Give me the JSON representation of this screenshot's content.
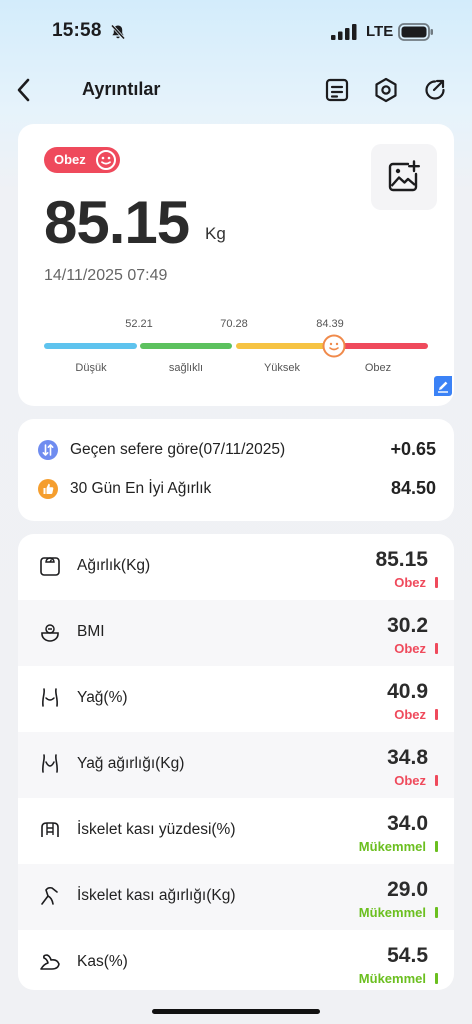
{
  "status_bar": {
    "time": "15:58",
    "network": "LTE"
  },
  "header": {
    "title": "Ayrıntılar"
  },
  "summary": {
    "status": "Obez",
    "weight": "85.15",
    "unit": "Kg",
    "date": "14/11/2025 07:49",
    "scale": {
      "thresholds": [
        "52.21",
        "70.28",
        "84.39"
      ],
      "segments": [
        {
          "label": "Düşük",
          "color": "#5ec3ee"
        },
        {
          "label": "sağlıklı",
          "color": "#5cc15e"
        },
        {
          "label": "Yüksek",
          "color": "#f6c343"
        },
        {
          "label": "Obez",
          "color": "#ef4a5c"
        }
      ],
      "marker_fraction": 0.755
    }
  },
  "compare": [
    {
      "label": "Geçen sefere göre(07/11/2025)",
      "value": "+0.65",
      "icon": "compare-arrows-icon"
    },
    {
      "label": "30 Gün En İyi Ağırlık",
      "value": "84.50",
      "icon": "thumbs-up-icon"
    }
  ],
  "metrics": [
    {
      "label": "Ağırlık(Kg)",
      "value": "85.15",
      "status": "Obez",
      "color": "#ef4a5c",
      "icon": "scale-icon"
    },
    {
      "label": "BMI",
      "value": "30.2",
      "status": "Obez",
      "color": "#ef4a5c",
      "icon": "bmi-icon"
    },
    {
      "label": "Yağ(%)",
      "value": "40.9",
      "status": "Obez",
      "color": "#ef4a5c",
      "icon": "body-fat-icon"
    },
    {
      "label": "Yağ ağırlığı(Kg)",
      "value": "34.8",
      "status": "Obez",
      "color": "#ef4a5c",
      "icon": "fat-weight-icon"
    },
    {
      "label": "İskelet kası yüzdesi(%)",
      "value": "34.0",
      "status": "Mükemmel",
      "color": "#6bbf1f",
      "icon": "skeletal-muscle-icon"
    },
    {
      "label": "İskelet kası ağırlığı(Kg)",
      "value": "29.0",
      "status": "Mükemmel",
      "color": "#6bbf1f",
      "icon": "muscle-mass-icon"
    },
    {
      "label": "Kas(%)",
      "value": "54.5",
      "status": "Mükemmel",
      "color": "#6bbf1f",
      "icon": "muscle-arm-icon"
    }
  ],
  "colors": {
    "danger": "#ef4a5c",
    "good": "#6bbf1f",
    "accent": "#3b82f6"
  }
}
